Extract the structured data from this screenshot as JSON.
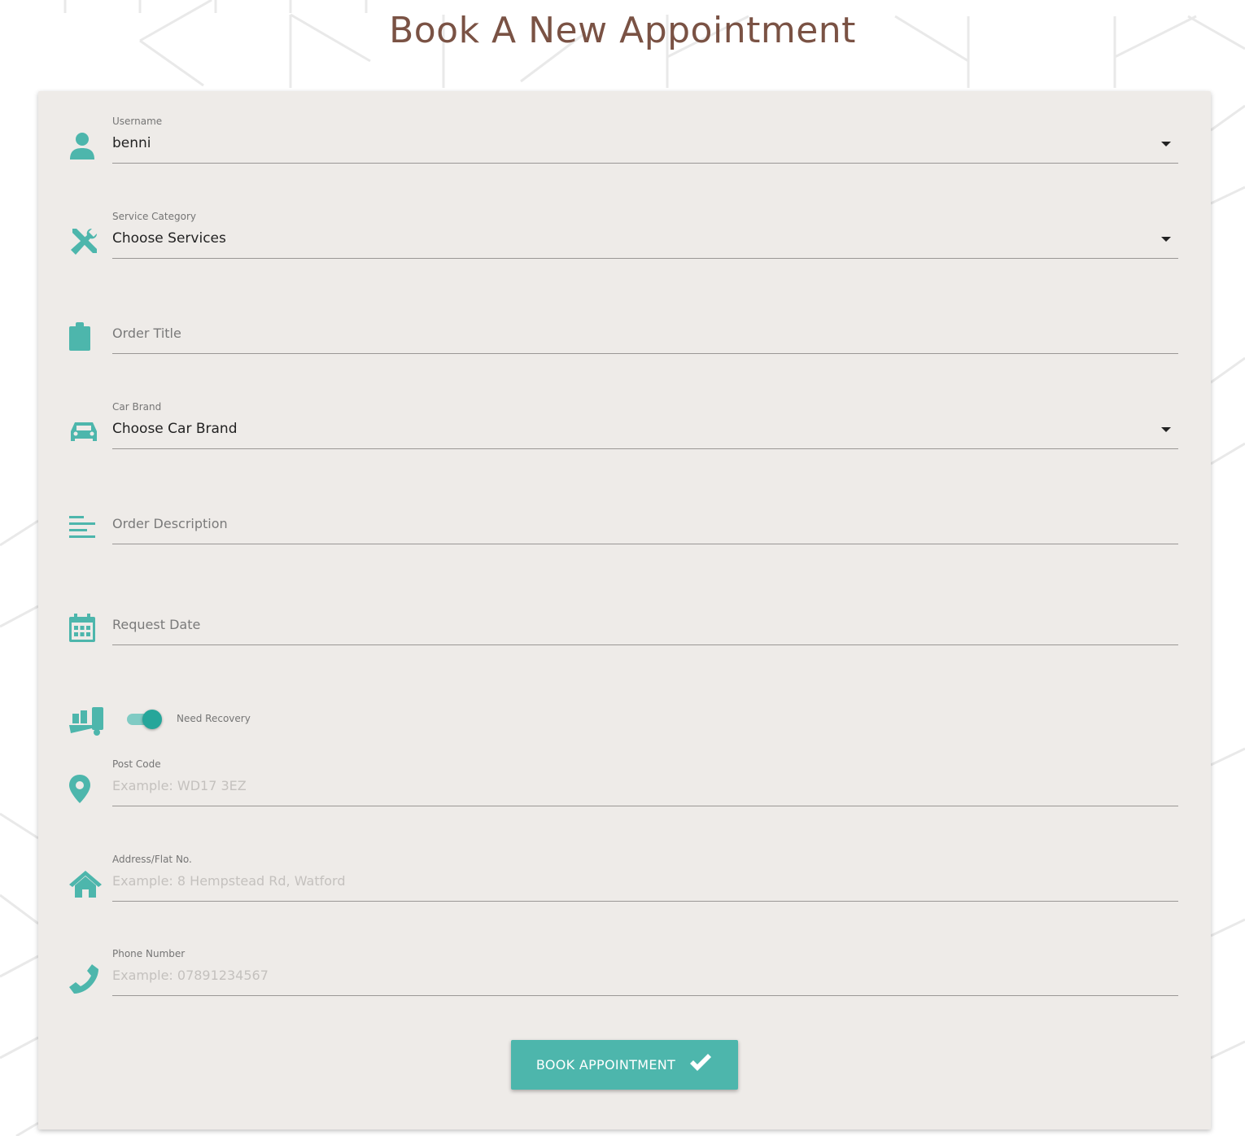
{
  "page": {
    "title": "Book A New Appointment"
  },
  "colors": {
    "accent": "#4db6ac",
    "title": "#7a5244",
    "card": "#eeebe8"
  },
  "form": {
    "username": {
      "label": "Username",
      "value": "benni",
      "icon": "person-icon"
    },
    "service_category": {
      "label": "Service Category",
      "value": "Choose Services",
      "icon": "tools-icon"
    },
    "order_title": {
      "label": "Order Title",
      "icon": "clipboard-icon"
    },
    "car_brand": {
      "label": "Car Brand",
      "value": "Choose Car Brand",
      "icon": "car-icon"
    },
    "order_description": {
      "label": "Order Description",
      "icon": "text-align-left-icon"
    },
    "request_date": {
      "label": "Request Date",
      "icon": "calendar-icon"
    },
    "need_recovery": {
      "label": "Need Recovery",
      "checked": true,
      "icon": "tow-truck-icon"
    },
    "post_code": {
      "label": "Post Code",
      "placeholder": "Example: WD17 3EZ",
      "icon": "location-pin-icon"
    },
    "address": {
      "label": "Address/Flat No.",
      "placeholder": "Example: 8 Hempstead Rd, Watford",
      "icon": "home-icon"
    },
    "phone": {
      "label": "Phone Number",
      "placeholder": "Example: 07891234567",
      "icon": "phone-icon"
    },
    "submit": {
      "label": "BOOK APPOINTMENT",
      "icon": "checkmark-icon"
    }
  }
}
